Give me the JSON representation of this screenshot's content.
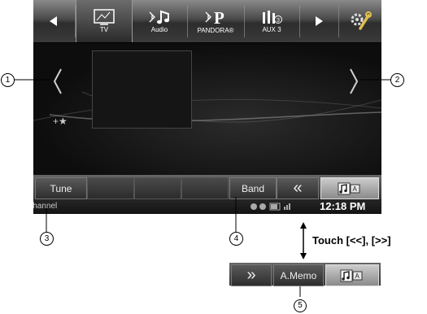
{
  "top_bar": {
    "sources": [
      {
        "label": "TV",
        "icon": "tv-icon"
      },
      {
        "label": "Audio",
        "icon": "bluetooth-audio-icon"
      },
      {
        "label": "PANDORA®",
        "icon": "bluetooth-pandora-icon"
      },
      {
        "label": "AUX 3",
        "icon": "aux-icon"
      }
    ]
  },
  "main": {
    "favorite_label": "+★"
  },
  "bottom_bar": {
    "tune_label": "Tune",
    "band_label": "Band",
    "rewind_label": "«"
  },
  "status_bar": {
    "channel_label": "Channel",
    "time": "12:18 PM"
  },
  "annotations": {
    "callout_1": "1",
    "callout_2": "2",
    "callout_3": "3",
    "callout_4": "4",
    "callout_5": "5",
    "touch_text": "Touch [<<], [>>]"
  },
  "memo_bar": {
    "forward_label": "»",
    "amemo_label": "A.Memo"
  }
}
